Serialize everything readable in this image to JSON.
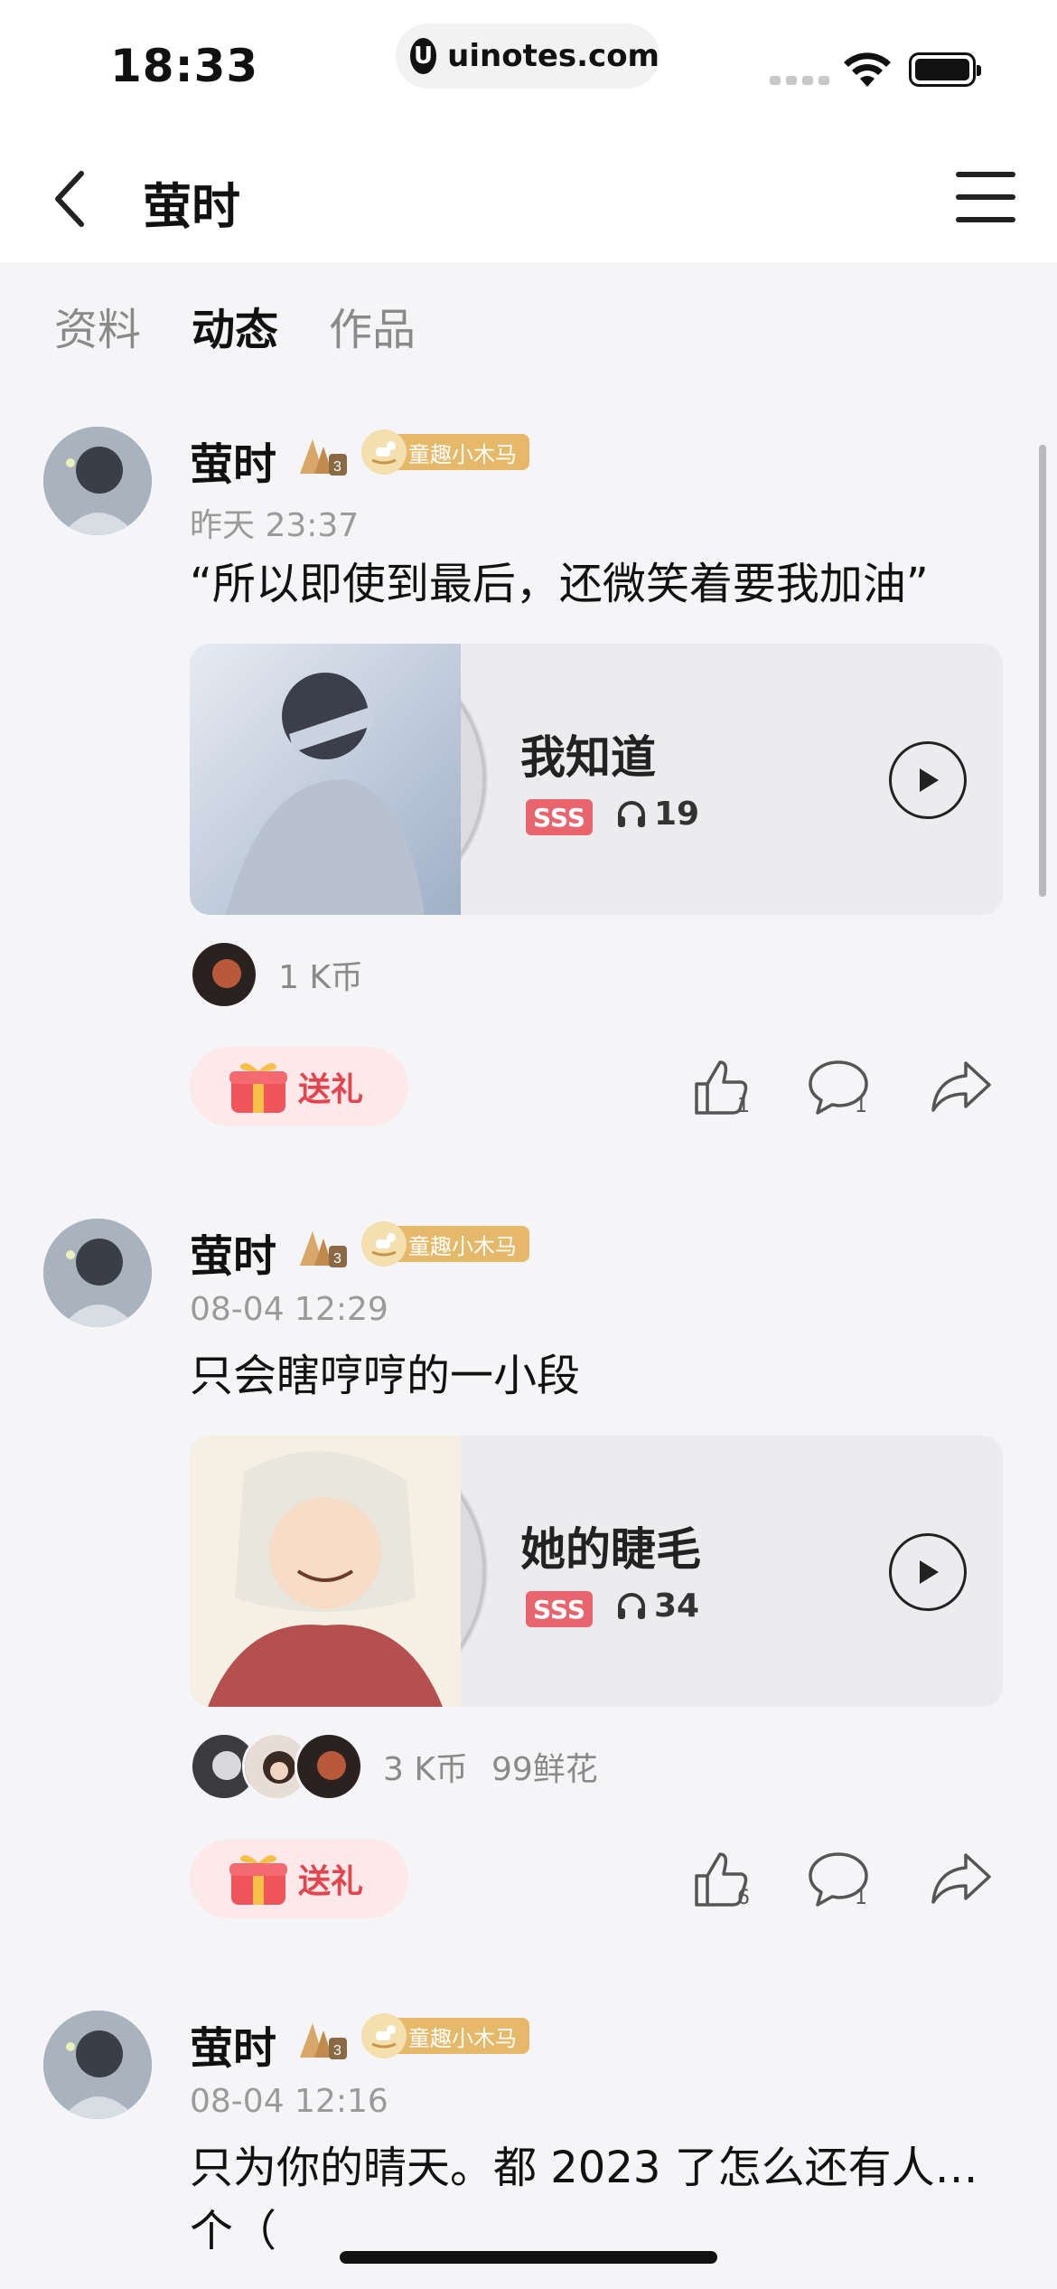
{
  "status_bar": {
    "time": "18:33",
    "url": "uinotes.com",
    "url_logo": "U"
  },
  "nav": {
    "title": "萤时"
  },
  "tabs": [
    {
      "label": "资料",
      "active": false
    },
    {
      "label": "动态",
      "active": true
    },
    {
      "label": "作品",
      "active": false
    }
  ],
  "posts": [
    {
      "author": "萤时",
      "vip_label": "童趣小木马",
      "time": "昨天 23:37",
      "text": "“所以即使到最后，还微笑着要我加油”",
      "song": {
        "title": "我知道",
        "grade": "SSS",
        "plays": "19"
      },
      "support": [
        "1 K币"
      ],
      "gift_label": "送礼",
      "likes": "1",
      "comments": "1"
    },
    {
      "author": "萤时",
      "vip_label": "童趣小木马",
      "time": "08-04 12:29",
      "text": "只会瞎哼哼的一小段",
      "song": {
        "title": "她的睫毛",
        "grade": "SSS",
        "plays": "34"
      },
      "support": [
        "3 K币",
        "99鲜花"
      ],
      "gift_label": "送礼",
      "likes": "6",
      "comments": "1"
    },
    {
      "author": "萤时",
      "vip_label": "童趣小木马",
      "time": "08-04 12:16",
      "text": "只为你的晴天。都 2023 了怎么还有人…个（"
    }
  ],
  "colors": {
    "accent_red": "#e4444d",
    "vip_gold": "#e5b86a",
    "sss_red": "#e8656d"
  }
}
